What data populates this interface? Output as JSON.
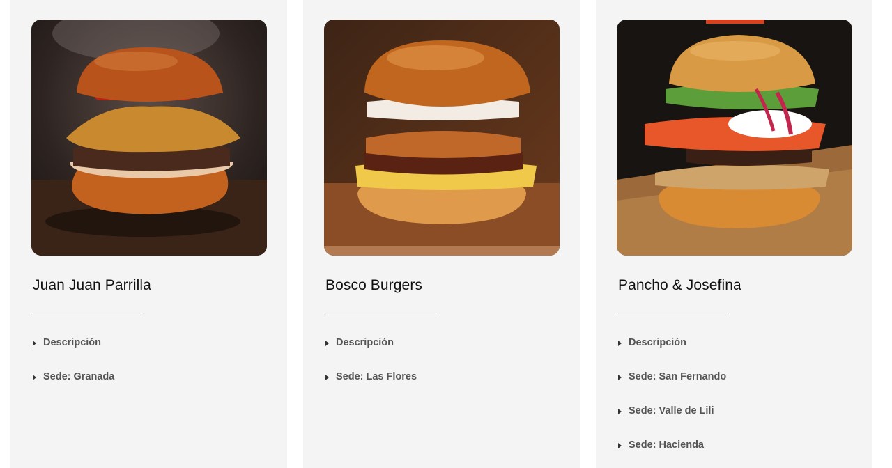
{
  "cards": [
    {
      "title": "Juan Juan Parrilla",
      "image_icon": "burger-photo-icon",
      "links": [
        "Descripción",
        "Sede: Granada"
      ]
    },
    {
      "title": "Bosco Burgers",
      "image_icon": "burger-photo-icon",
      "links": [
        "Descripción",
        "Sede: Las Flores"
      ]
    },
    {
      "title": "Pancho & Josefina",
      "image_icon": "burger-photo-icon",
      "links": [
        "Descripción",
        "Sede: San Fernando",
        "Sede: Valle de Lili",
        "Sede: Hacienda"
      ]
    }
  ],
  "colors": {
    "card_bg": "#f4f4f4",
    "title": "#111111",
    "link": "#555555",
    "divider": "#9a9a9a"
  }
}
